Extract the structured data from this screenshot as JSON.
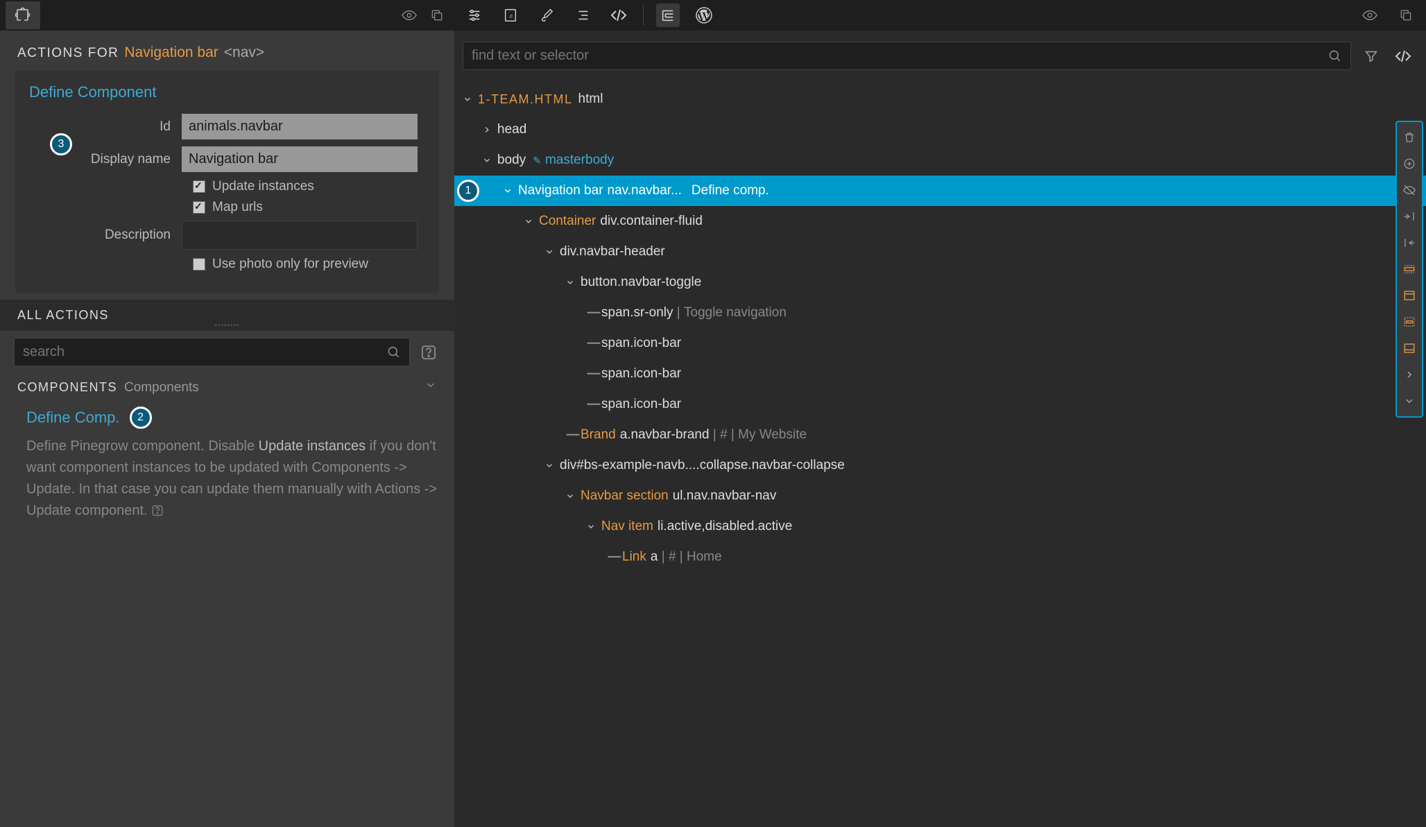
{
  "left": {
    "actions_label": "ACTIONS FOR",
    "target_name": "Navigation bar",
    "target_tag": "<nav>",
    "define_title": "Define Component",
    "form": {
      "id_label": "Id",
      "id_value": "animals.navbar",
      "display_label": "Display name",
      "display_value": "Navigation bar",
      "update_instances": "Update instances",
      "map_urls": "Map urls",
      "description_label": "Description",
      "use_photo": "Use photo only for preview"
    },
    "all_actions": "ALL ACTIONS",
    "search_placeholder": "search",
    "components_h": "COMPONENTS",
    "components_s": "Components",
    "define_comp": "Define Comp.",
    "desc_p1": "Define Pinegrow component. Disable ",
    "desc_em": "Update instances",
    "desc_p2": " if you don't want component instances to be updated with Components -> Update. In that case you can update them manually with Actions -> Update component. "
  },
  "right": {
    "find_placeholder": "find text or selector",
    "file": "1-TEAM.HTML",
    "file_el": "html",
    "body_link": "masterbody",
    "selected_name": "Navigation bar",
    "selected_el": "nav.navbar...",
    "selected_action": "Define comp.",
    "rows": {
      "head": "head",
      "body": "body",
      "container_nm": "Container",
      "container_el": "div.container-fluid",
      "navheader": "div.navbar-header",
      "toggle": "button.navbar-toggle",
      "sr": "span.sr-only",
      "sr_txt": "Toggle navigation",
      "iconbar": "span.icon-bar",
      "brand_nm": "Brand",
      "brand_el": "a.navbar-brand",
      "brand_txt": "# | My Website",
      "collapse": "div#bs-example-navb....collapse.navbar-collapse",
      "navsec_nm": "Navbar section",
      "navsec_el": "ul.nav.navbar-nav",
      "navitem_nm": "Nav item",
      "navitem_el": "li.active,disabled.active",
      "link_nm": "Link",
      "link_el": "a",
      "link_txt": "# | Home"
    }
  },
  "badges": {
    "b1": "1",
    "b2": "2",
    "b3": "3"
  }
}
